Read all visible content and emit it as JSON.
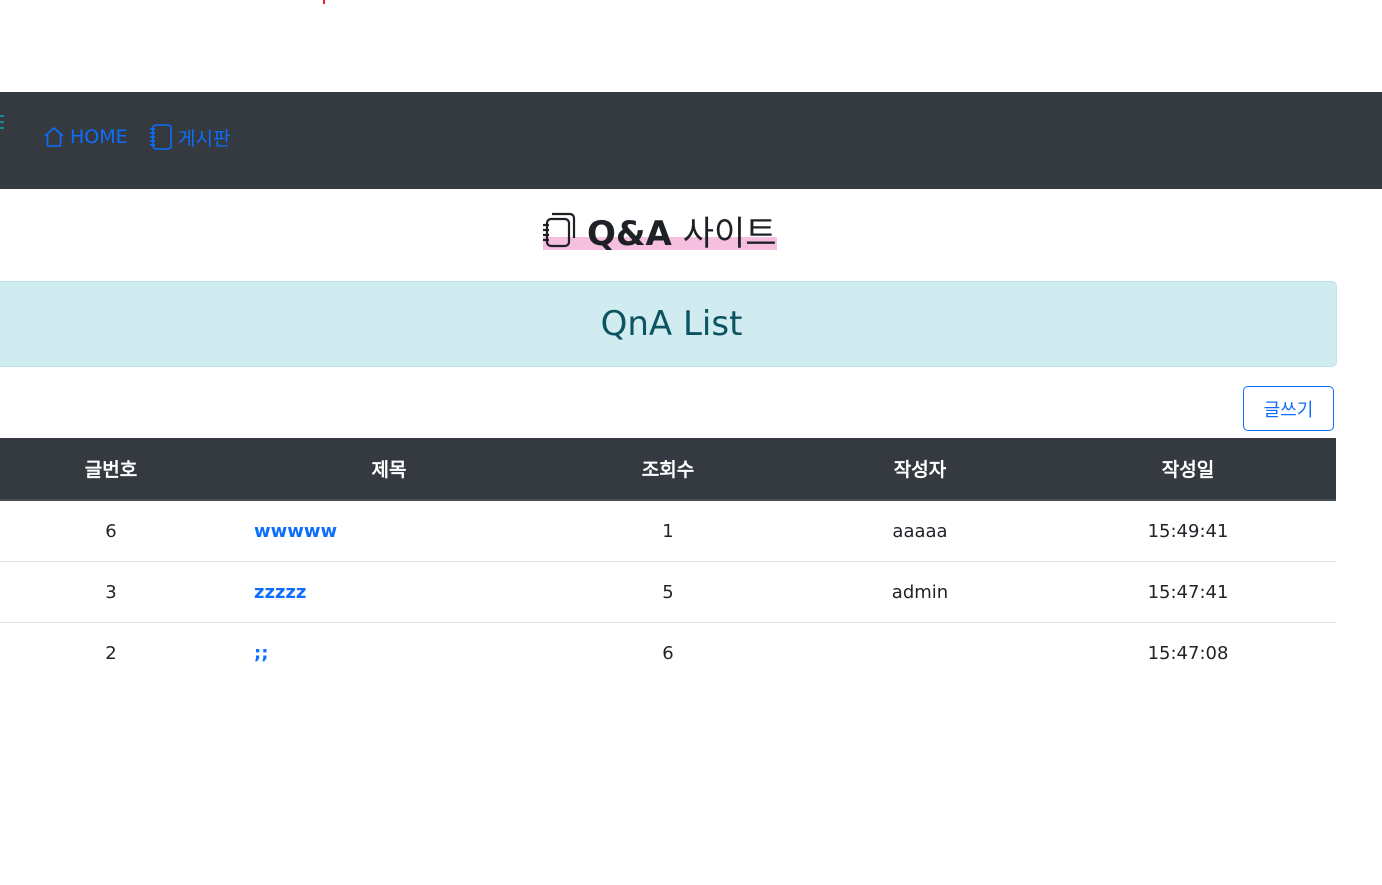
{
  "nav": {
    "home_label": "HOME",
    "board_label": "게시판"
  },
  "site": {
    "title_bold": "Q&A",
    "title_rest": "사이트"
  },
  "alert": {
    "heading": "QnA List"
  },
  "toolbar": {
    "write_label": "글쓰기"
  },
  "table": {
    "headers": [
      "글번호",
      "제목",
      "조회수",
      "작성자",
      "작성일"
    ],
    "rows": [
      {
        "no": "6",
        "title": "wwwww",
        "views": "1",
        "author": "aaaaa",
        "date": "15:49:41"
      },
      {
        "no": "3",
        "title": "zzzzz",
        "views": "5",
        "author": "admin",
        "date": "15:47:41"
      },
      {
        "no": "2",
        "title": ";;",
        "views": "6",
        "author": "",
        "date": "15:47:08"
      }
    ]
  },
  "colors": {
    "navbar_bg": "#343a40",
    "link": "#0d6efd",
    "alert_bg": "#d1ecf1",
    "alert_text": "#0c5460",
    "title_highlight": "#f6bfe0"
  },
  "icons": {
    "home": "house-icon",
    "board": "journal-icon",
    "title": "journals-icon"
  }
}
